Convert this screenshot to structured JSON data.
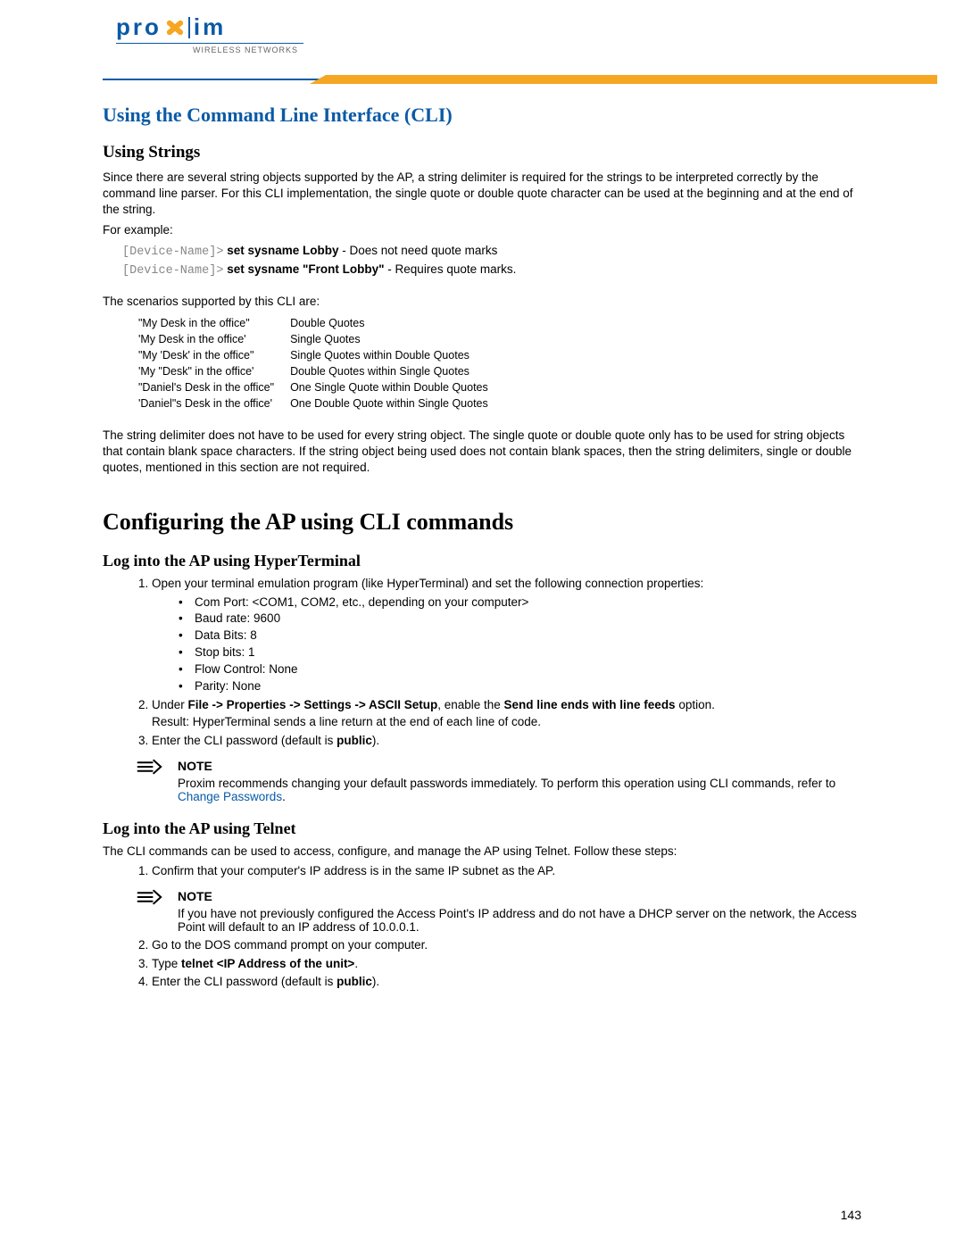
{
  "brand": {
    "name_left": "pro",
    "name_right": "im",
    "tagline": "WIRELESS NETWORKS"
  },
  "section_title": "Using the Command Line Interface (CLI)",
  "using_strings": {
    "heading": "Using Strings",
    "intro": "Since there are several string objects supported by the AP, a string delimiter is required for the strings to be interpreted correctly by the command line parser. For this CLI implementation, the single quote or double quote character can be used at the beginning and at the end of the string.",
    "for_example_label": "For example:",
    "ex1_prompt": "[Device-Name]>",
    "ex1_cmd": "set sysname Lobby",
    "ex1_note": " - Does not need quote marks",
    "ex2_prompt": "[Device-Name]>",
    "ex2_cmd": "set sysname \"Front Lobby\"",
    "ex2_note": " - Requires quote marks.",
    "scenarios_label": "The scenarios supported by this CLI are:",
    "scenarios": [
      {
        "s": "\"My Desk in the office\"",
        "d": "Double Quotes"
      },
      {
        "s": "'My Desk in the office'",
        "d": "Single Quotes"
      },
      {
        "s": "\"My 'Desk' in the office\"",
        "d": "Single Quotes within Double Quotes"
      },
      {
        "s": "'My \"Desk\" in the office'",
        "d": "Double Quotes within Single Quotes"
      },
      {
        "s": "\"Daniel's Desk in the office\"",
        "d": "One Single Quote within Double Quotes"
      },
      {
        "s": "'Daniel\"s Desk in the office'",
        "d": "One Double Quote within Single Quotes"
      }
    ],
    "closing": "The string delimiter does not have to be used for every string object. The single quote or double quote only has to be used for string objects that contain blank space characters. If the string object being used does not contain blank spaces, then the string delimiters, single or double quotes, mentioned in this section are not required."
  },
  "configuring": {
    "heading": "Configuring the AP using CLI commands",
    "hyper": {
      "heading": "Log into the AP using HyperTerminal",
      "step1": "Open your terminal emulation program (like HyperTerminal) and set the following connection properties:",
      "bullets": [
        "Com Port: <COM1, COM2, etc., depending on your computer>",
        "Baud rate: 9600",
        "Data Bits: 8",
        "Stop bits: 1",
        "Flow Control: None",
        "Parity: None"
      ],
      "step2_pre": "Under ",
      "step2_b1": "File -> Properties -> Settings -> ASCII Setup",
      "step2_mid": ", enable the ",
      "step2_b2": "Send line ends with line feeds",
      "step2_post": " option.",
      "step2_result": "Result: HyperTerminal sends a line return at the end of each line of code.",
      "step3_pre": "Enter the CLI password (default is ",
      "step3_b": "public",
      "step3_post": ").",
      "note_label": "NOTE",
      "note_text_pre": "Proxim recommends changing your default passwords immediately. To perform this operation using CLI commands, refer to ",
      "note_link": "Change Passwords",
      "note_text_post": "."
    },
    "telnet": {
      "heading": "Log into the AP using Telnet",
      "intro": "The CLI commands can be used to access, configure, and manage the AP using Telnet. Follow these steps:",
      "step1": "Confirm that your computer's IP address is in the same IP subnet as the AP.",
      "note_label": "NOTE",
      "note_text": "If you have not previously configured the Access Point's IP address and do not have a DHCP server on the network, the Access Point will default to an IP address of 10.0.0.1.",
      "step2": "Go to the DOS command prompt on your computer.",
      "step3_pre": "Type ",
      "step3_b": "telnet <IP Address of the unit>",
      "step3_post": ".",
      "step4_pre": "Enter the CLI password (default is ",
      "step4_b": "public",
      "step4_post": ")."
    }
  },
  "page_number": "143"
}
